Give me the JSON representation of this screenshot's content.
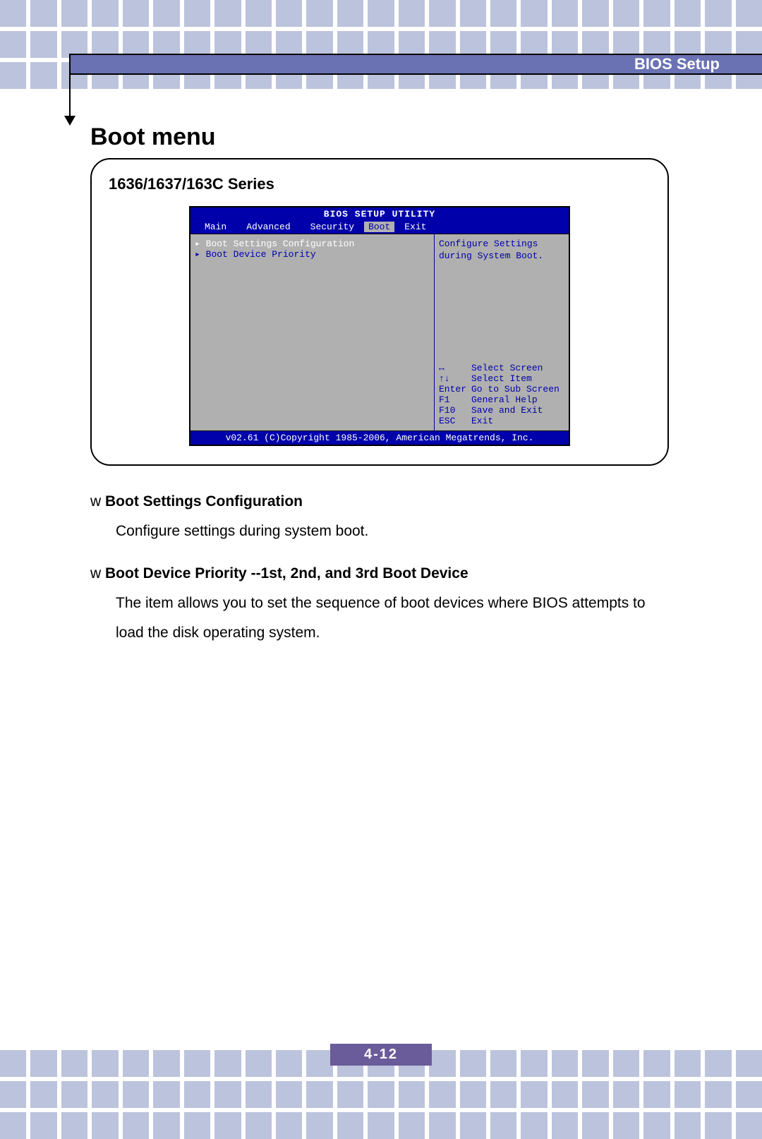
{
  "header": {
    "title": "BIOS Setup"
  },
  "page": {
    "heading": "Boot menu",
    "series": "1636/1637/163C Series",
    "number": "4-12"
  },
  "bios": {
    "title": "BIOS SETUP UTILITY",
    "tabs": {
      "main": "Main",
      "advanced": "Advanced",
      "security": "Security",
      "boot": "Boot",
      "exit": "Exit"
    },
    "left_items": [
      "Boot Settings Configuration",
      "Boot Device Priority"
    ],
    "hint_line1": "Configure Settings",
    "hint_line2": "during System Boot.",
    "keys": [
      {
        "k": "↔",
        "v": "Select Screen"
      },
      {
        "k": "↑↓",
        "v": "Select Item"
      },
      {
        "k": "Enter",
        "v": "Go to Sub Screen"
      },
      {
        "k": "F1",
        "v": "General Help"
      },
      {
        "k": "F10",
        "v": "Save and Exit"
      },
      {
        "k": "ESC",
        "v": "Exit"
      }
    ],
    "footer": "v02.61 (C)Copyright 1985-2006, American Megatrends, Inc."
  },
  "notes": [
    {
      "bullet": "w",
      "label": "Boot Settings Configuration",
      "desc": "Configure settings during system boot."
    },
    {
      "bullet": "w",
      "label": "Boot Device Priority --1st, 2nd, and 3rd Boot Device",
      "desc": "The item allows you to set the sequence of boot devices where BIOS attempts to load the disk operating system."
    }
  ]
}
